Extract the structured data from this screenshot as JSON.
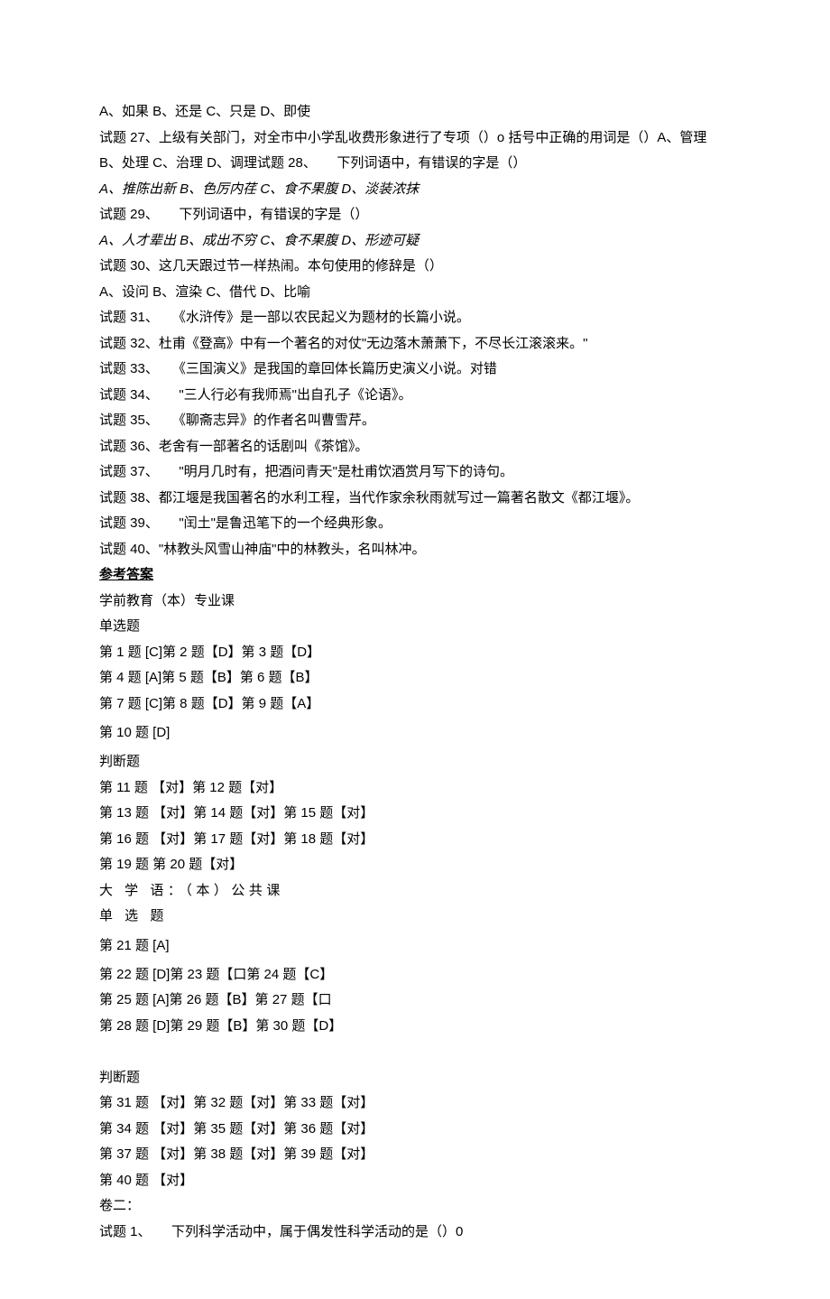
{
  "lines": [
    {
      "text": "A、如果 B、还是 C、只是 D、即使"
    },
    {
      "text": "试题 27、上级有关部门，对全市中小学乱收费形象进行了专项（）o 括号中正确的用词是（）A、管理 B、处理 C、治理 D、调理试题 28、　　下列词语中，有错误的字是（）"
    },
    {
      "text": "A、推陈出新 B、色厉内荏 C、食不果腹 D、淡装浓抹",
      "italic": true
    },
    {
      "text": "试题 29、　　下列词语中，有错误的字是（）"
    },
    {
      "text": "A、人才辈出 B、成出不穷 C、食不果腹 D、形迹可疑",
      "italic": true
    },
    {
      "text": "试题 30、这几天跟过节一样热闹。本句使用的修辞是（）"
    },
    {
      "text": "A、设问 B、渲染 C、借代 D、比喻"
    },
    {
      "text": "试题 31、　　《水浒传》是一部以农民起义为题材的长篇小说。"
    },
    {
      "text": "试题 32、杜甫《登高》中有一个著名的对仗\"无边落木萧萧下，不尽长江滚滚来。\""
    },
    {
      "text": "试题 33、　　《三国演义》是我国的章回体长篇历史演义小说。对错"
    },
    {
      "text": "试题 34、　　\"三人行必有我师焉\"出自孔子《论语》。"
    },
    {
      "text": "试题 35、　　《聊斋志异》的作者名叫曹雪芹。"
    },
    {
      "text": "试题 36、老舍有一部著名的话剧叫《茶馆》。"
    },
    {
      "text": "试题 37、　　\"明月几时有，把酒问青天\"是杜甫饮酒赏月写下的诗句。"
    },
    {
      "text": "试题 38、都江堰是我国著名的水利工程，当代作家余秋雨就写过一篇著名散文《都江堰》。"
    },
    {
      "text": "试题 39、　　\"闰土\"是鲁迅笔下的一个经典形象。"
    },
    {
      "text": "试题 40、\"林教头风雪山神庙\"中的林教头，名叫林冲。"
    },
    {
      "text": "参考答案",
      "underline": true
    },
    {
      "text": "学前教育（本）专业课"
    },
    {
      "text": "单选题"
    },
    {
      "text": "第 1 题   [C]第 2 题【D】第 3 题【D】"
    },
    {
      "text": "第 4 题   [A]第 5 题【B】第 6 题【B】"
    },
    {
      "text": "第 7 题   [C]第 8 题【D】第 9 题【A】"
    },
    {
      "text": "第 10 题  [D]",
      "loose": true
    },
    {
      "text": "判断题"
    },
    {
      "text": "第 11 题 【对】第 12 题【对】"
    },
    {
      "text": "第 13 题 【对】第 14 题【对】第 15 题【对】"
    },
    {
      "text": "第 16 题 【对】第 17 题【对】第 18 题【对】"
    },
    {
      "text": "第 19 题  第 20 题【对】"
    },
    {
      "text": "大 学 语：（本）公共课",
      "spaced": true
    },
    {
      "text": "单 选 题",
      "spaced": true
    },
    {
      "text": "第 21 题  [A]",
      "loose": true
    },
    {
      "text": "第 22 题  [D]第 23 题【口第 24 题【C】"
    },
    {
      "text": "第 25 题  [A]第 26 题【B】第 27 题【口"
    },
    {
      "text": "第 28 题  [D]第 29 题【B】第 30 题【D】"
    },
    {
      "text": ""
    },
    {
      "text": "判断题"
    },
    {
      "text": "第 31 题 【对】第 32 题【对】第 33 题【对】"
    },
    {
      "text": "第 34 题 【对】第 35 题【对】第 36 题【对】"
    },
    {
      "text": "第 37 题 【对】第 38 题【对】第 39 题【对】"
    },
    {
      "text": "第 40 题 【对】"
    },
    {
      "text": "卷二："
    },
    {
      "text": "试题 1、　　下列科学活动中，属于偶发性科学活动的是（）0"
    }
  ]
}
